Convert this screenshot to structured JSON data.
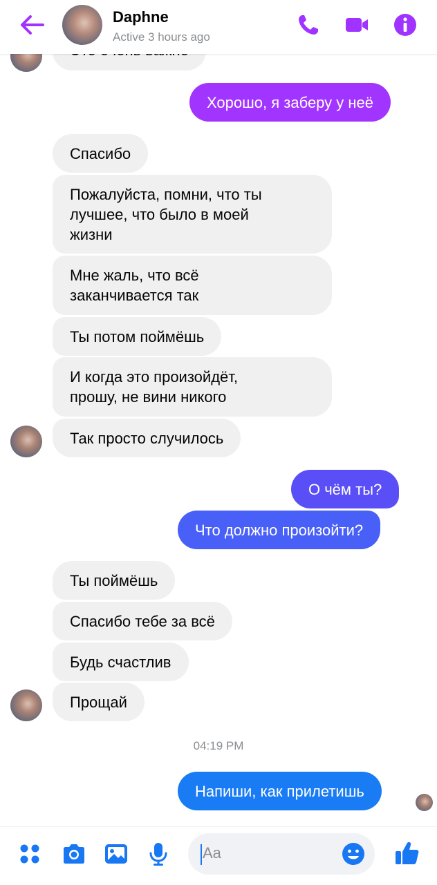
{
  "header": {
    "contact_name": "Daphne",
    "status": "Active 3 hours ago",
    "icons": [
      "back-arrow-icon",
      "phone-icon",
      "video-camera-icon",
      "info-icon"
    ],
    "accent_color": "#a033ff"
  },
  "messages": [
    {
      "side": "in",
      "text": "Это очень важно"
    },
    {
      "side": "out",
      "text": "Хорошо, я заберу у неё",
      "color": "#a234ff"
    },
    {
      "side": "in",
      "text": "Спасибо"
    },
    {
      "side": "in",
      "lines": [
        "Пожалуйста, помни, что ты",
        "лучшее, что было в моей",
        "жизни"
      ]
    },
    {
      "side": "in",
      "lines": [
        "Мне жаль, что всё",
        "заканчивается так"
      ]
    },
    {
      "side": "in",
      "text": "Ты потом поймёшь"
    },
    {
      "side": "in",
      "lines": [
        "И когда это произойдёт,",
        "прошу, не вини никого"
      ]
    },
    {
      "side": "in",
      "text": "Так просто случилось"
    },
    {
      "side": "out",
      "text": "О чём ты?",
      "color": "#5a4ff6"
    },
    {
      "side": "out",
      "text": "Что должно произойти?",
      "color": "#4860f7"
    },
    {
      "side": "in",
      "text": "Ты поймёшь"
    },
    {
      "side": "in",
      "text": "Спасибо тебе за всё"
    },
    {
      "side": "in",
      "text": "Будь счастлив"
    },
    {
      "side": "in",
      "text": "Прощай"
    },
    {
      "side": "out",
      "text": "Напиши, как прилетишь",
      "color": "#1a7cf5"
    }
  ],
  "timestamp": "04:19 PM",
  "composer": {
    "placeholder": "Aa",
    "icons": [
      "apps-grid-icon",
      "camera-icon",
      "gallery-icon",
      "microphone-icon",
      "emoji-icon",
      "thumbs-up-icon"
    ],
    "accent_color": "#1877f2"
  }
}
